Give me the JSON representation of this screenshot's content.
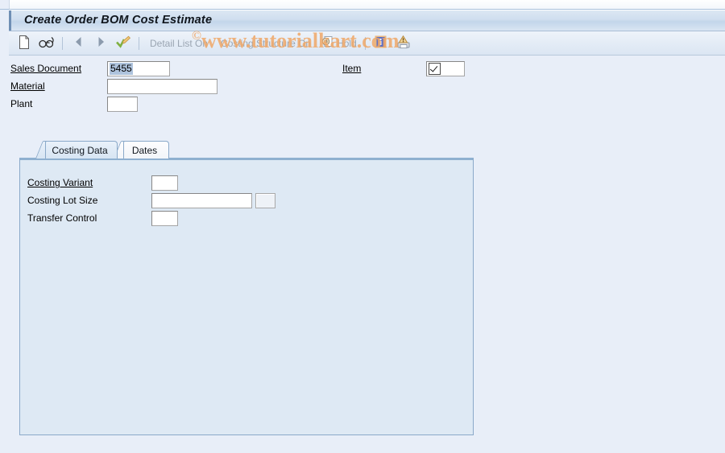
{
  "window": {
    "title": "Create Order BOM Cost Estimate"
  },
  "toolbar": {
    "items": [
      {
        "name": "new-document",
        "icon": "document-icon",
        "label": ""
      },
      {
        "name": "find-glasses",
        "icon": "glasses-icon",
        "label": ""
      },
      {
        "name": "previous",
        "icon": "arrow-left-icon",
        "label": ""
      },
      {
        "name": "next",
        "icon": "arrow-right-icon",
        "label": ""
      },
      {
        "name": "check-costing",
        "icon": "check-pencil-icon",
        "label": ""
      },
      {
        "name": "detail-list-on",
        "icon": "",
        "label": "Detail List On"
      },
      {
        "name": "costing-structure-on",
        "icon": "",
        "label": "Costing Structure On"
      },
      {
        "name": "hold",
        "icon": "hold-icon",
        "label": "Hold"
      },
      {
        "name": "information",
        "icon": "info-icon",
        "label": ""
      },
      {
        "name": "print-preview",
        "icon": "printer-warning-icon",
        "label": ""
      }
    ],
    "detail_list_label": "Detail List On",
    "costing_structure_label": "Costing Structure On",
    "hold_label": "Hold"
  },
  "header_form": {
    "sales_document": {
      "label": "Sales Document",
      "value": "5455",
      "placeholder": ""
    },
    "item": {
      "label": "Item",
      "value": "",
      "placeholder": ""
    },
    "material": {
      "label": "Material",
      "value": "",
      "placeholder": ""
    },
    "plant": {
      "label": "Plant",
      "value": "",
      "placeholder": ""
    }
  },
  "tabs": [
    {
      "label": "Costing Data",
      "active": true
    },
    {
      "label": "Dates",
      "active": false
    }
  ],
  "costing_data": {
    "costing_variant": {
      "label": "Costing Variant",
      "value": "",
      "placeholder": ""
    },
    "costing_lot_size": {
      "label": "Costing Lot Size",
      "value": "",
      "placeholder": ""
    },
    "transfer_control": {
      "label": "Transfer Control",
      "value": "",
      "placeholder": ""
    }
  },
  "watermark": {
    "symbol": "©",
    "text": "www.tutorialkart.com"
  },
  "colors": {
    "page_background": "#e8eef8",
    "panel_background": "#dee9f4",
    "panel_border": "#8aa9c9",
    "selection": "#aec3dd",
    "watermark": "#f0a868",
    "disabled_text": "#9aa5b2"
  }
}
